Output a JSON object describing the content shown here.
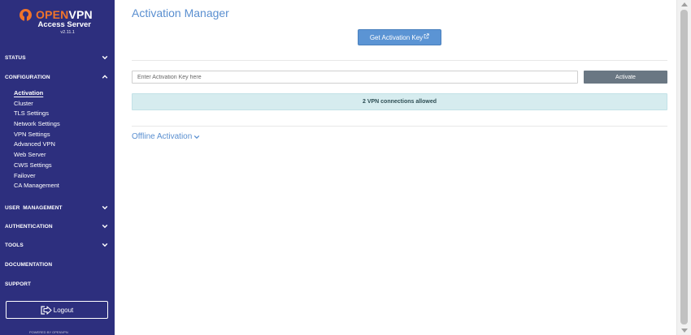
{
  "sidebar": {
    "brand_open": "OPEN",
    "brand_vpn": "VPN",
    "brand_sub": "Access Server",
    "version": "v2.11.1",
    "sections": [
      {
        "label": "STATUS",
        "expanded": false
      },
      {
        "label": "CONFIGURATION",
        "expanded": true
      },
      {
        "label": "USER  MANAGEMENT",
        "expanded": false
      },
      {
        "label": "AUTHENTICATION",
        "expanded": false
      },
      {
        "label": "TOOLS",
        "expanded": false
      },
      {
        "label": "DOCUMENTATION"
      },
      {
        "label": "SUPPORT"
      }
    ],
    "config_items": [
      "Activation",
      "Cluster",
      "TLS Settings",
      "Network Settings",
      "VPN Settings",
      "Advanced VPN",
      "Web Server",
      "CWS Settings",
      "Failover",
      "CA Management"
    ],
    "active_item": "Activation",
    "logout_label": "Logout",
    "powered_by": "POWERED BY OPENVPN"
  },
  "main": {
    "title": "Activation Manager",
    "get_key_label": "Get Activation Key",
    "input_placeholder": "Enter Activation Key here",
    "activate_label": "Activate",
    "connections_info": "2 VPN connections allowed",
    "offline_label": "Offline Activation"
  },
  "colors": {
    "sidebar_bg": "#2d2f7e",
    "brand_orange": "#f0742b",
    "accent_blue": "#5b94d4",
    "activate_gray": "#6a7783",
    "info_bg": "#d6ecef"
  },
  "icons": {
    "section_chevron": "chevron-icon",
    "external": "external-link-icon",
    "logout": "logout-icon"
  }
}
